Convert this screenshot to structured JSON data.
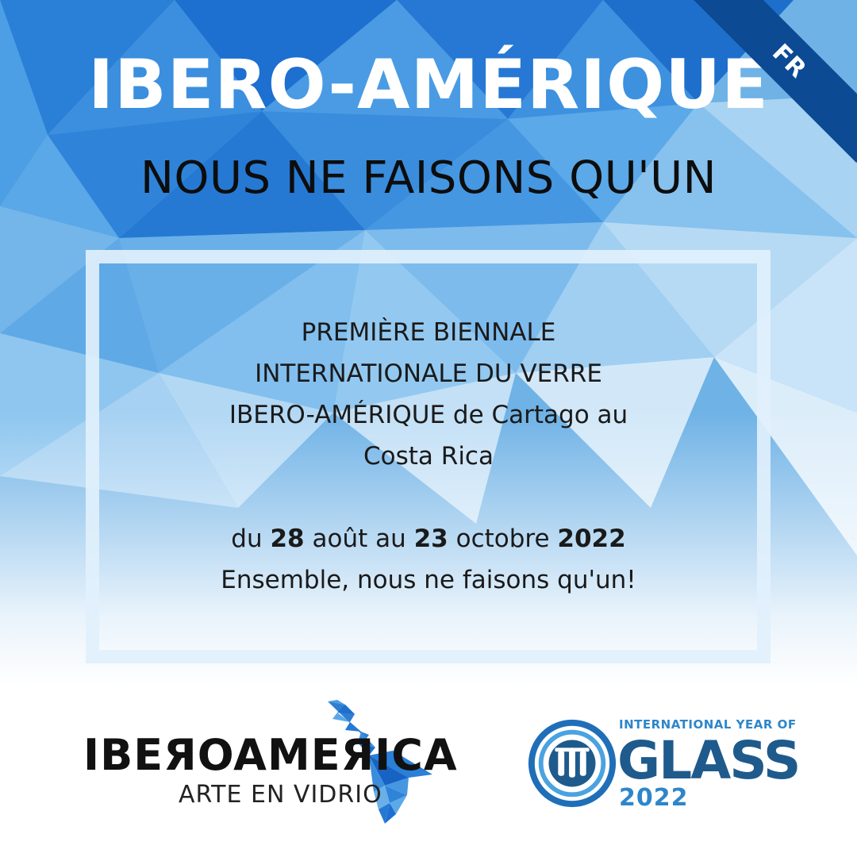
{
  "header": {
    "title": "IBERO-AMÉRIQUE",
    "subtitle": "NOUS NE FAISONS QU'UN",
    "language_badge": "FR"
  },
  "announcement": {
    "line1": "PREMIÈRE BIENNALE",
    "line2": "INTERNATIONALE DU VERRE",
    "line3": "IBERO-AMÉRIQUE de Cartago au",
    "line4": "Costa Rica",
    "date_prefix": "du",
    "start_day": "28",
    "start_month": "août au",
    "end_day": "23",
    "end_month": "octobre",
    "year": "2022",
    "closing": "Ensemble, nous ne faisons qu'un!"
  },
  "logos": {
    "iberoamerica": {
      "wordmark": "IBEЯOAMEЯICA",
      "tagline": "ARTE EN VIDRIO"
    },
    "glass": {
      "top_text": "INTERNATIONAL YEAR OF",
      "word": "GLASS",
      "year": "2022"
    }
  },
  "colors": {
    "ribbon": "#0c4a94",
    "deep_blue": "#1763c4",
    "light_blue": "#8fc6ee",
    "glass_blue": "#2e86c9"
  },
  "icons": {
    "map": "latin-america-map-icon",
    "emblem": "glass-year-emblem-icon"
  }
}
